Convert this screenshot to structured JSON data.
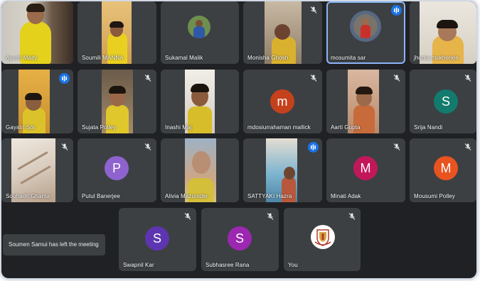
{
  "toast": {
    "message": "Soumen Samui has left the meeting"
  },
  "participants": [
    {
      "name": "Ayush Maity"
    },
    {
      "name": "Soumili MANNA"
    },
    {
      "name": "Sukamal Malik"
    },
    {
      "name": "Monisha Ghosh"
    },
    {
      "name": "mosumita sar"
    },
    {
      "name": "jhuma mukherjee"
    },
    {
      "name": "Gayatri Sor"
    },
    {
      "name": "Sujata Polley"
    },
    {
      "name": "Inashi Maj"
    },
    {
      "name": "mdosiurrahaman mallick",
      "initial": "m",
      "color": "#c5411c"
    },
    {
      "name": "Aarti Gupta"
    },
    {
      "name": "Srija Nandi",
      "initial": "S",
      "color": "#127b6d"
    },
    {
      "name": "Souhadri Ghanta"
    },
    {
      "name": "Putul Banerjee",
      "initial": "P",
      "color": "#8e63ce"
    },
    {
      "name": "Alivia Mazumder"
    },
    {
      "name": "SATTYAKI Hazra"
    },
    {
      "name": "Minati Adak",
      "initial": "M",
      "color": "#c2185b"
    },
    {
      "name": "Mousumi Polley",
      "initial": "M",
      "color": "#e8531f"
    },
    {
      "name": "Swapnil Kar",
      "initial": "S",
      "color": "#5e35b1"
    },
    {
      "name": "Subhasree Rana",
      "initial": "S",
      "color": "#9c27b0"
    },
    {
      "name": "You"
    }
  ]
}
